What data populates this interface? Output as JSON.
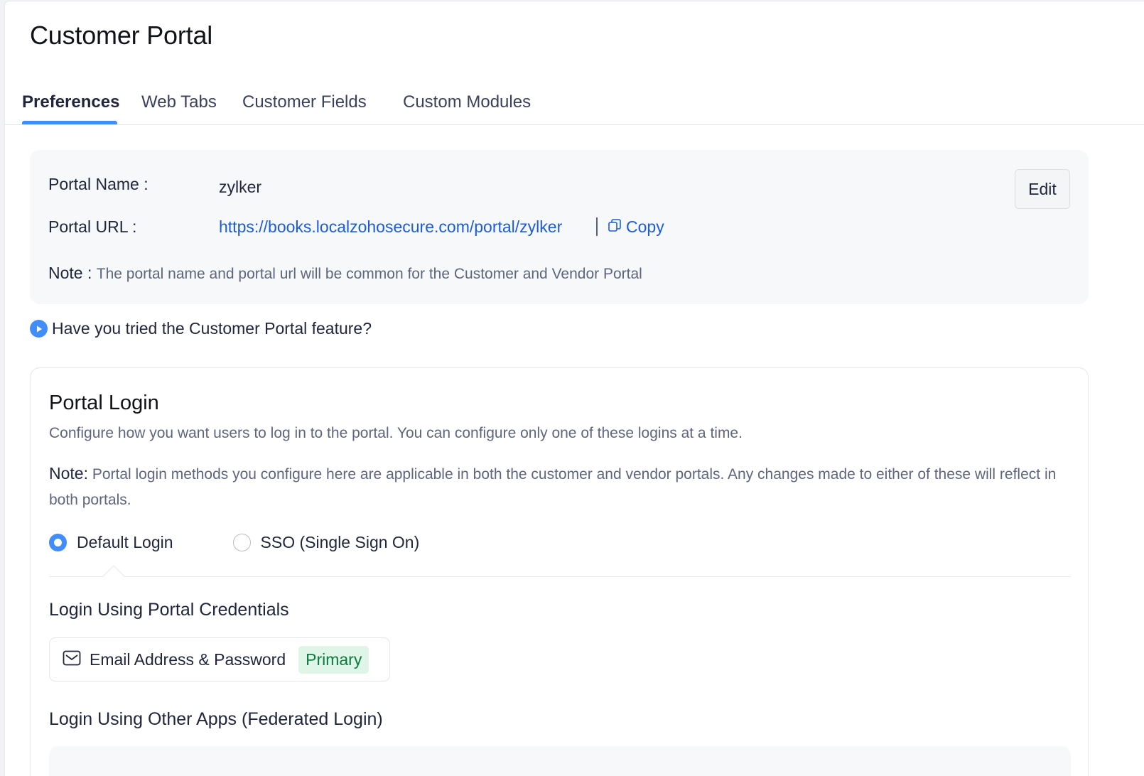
{
  "header": {
    "title": "Customer Portal"
  },
  "tabs": [
    {
      "label": "Preferences",
      "active": true
    },
    {
      "label": "Web Tabs",
      "active": false
    },
    {
      "label": "Customer Fields",
      "active": false
    },
    {
      "label": "Custom Modules",
      "active": false
    }
  ],
  "portal_info": {
    "name_label": "Portal Name :",
    "name_value": "zylker",
    "url_label": "Portal URL :",
    "url_value": "https://books.localzohosecure.com/portal/zylker",
    "copy_label": "Copy",
    "edit_label": "Edit",
    "note_key": "Note :",
    "note_text": "The portal name and portal url will be common for the Customer and Vendor Portal"
  },
  "tried_feature": {
    "label": "Have you tried the Customer Portal feature?"
  },
  "portal_login": {
    "title": "Portal Login",
    "description": "Configure how you want users to log in to the portal. You can configure only one of these logins at a time.",
    "note_key": "Note:",
    "note_text": "Portal login methods you configure here are applicable in both the customer and vendor portals. Any changes made to either of these will reflect in both portals.",
    "options": [
      {
        "label": "Default Login",
        "selected": true
      },
      {
        "label": "SSO (Single Sign On)",
        "selected": false
      }
    ],
    "credentials_heading": "Login Using Portal Credentials",
    "credential_method": "Email Address & Password",
    "credential_badge": "Primary",
    "federated_heading": "Login Using Other Apps (Federated Login)"
  },
  "colors": {
    "accent": "#408dfb",
    "link": "#1c5cd8",
    "badge_bg": "#def5e7",
    "badge_text": "#0f7a3f"
  }
}
